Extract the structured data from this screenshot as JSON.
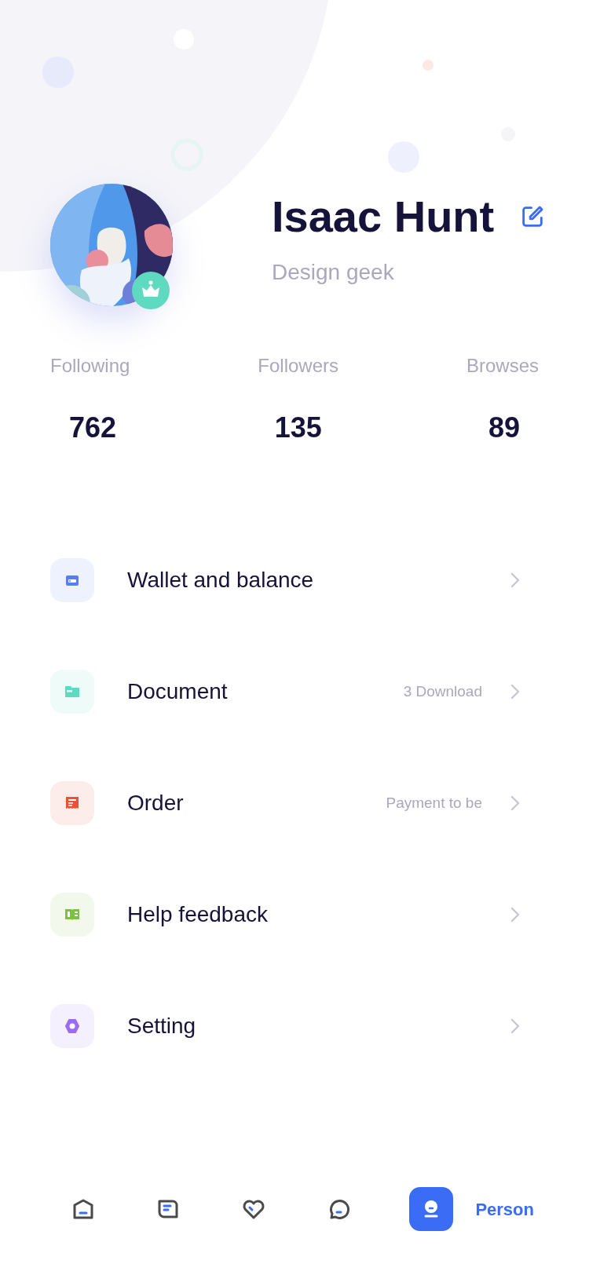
{
  "profile": {
    "name": "Isaac Hunt",
    "subtitle": "Design geek"
  },
  "stats": [
    {
      "label": "Following",
      "value": "762"
    },
    {
      "label": "Followers",
      "value": "135"
    },
    {
      "label": "Browses",
      "value": "89"
    }
  ],
  "menu": [
    {
      "kind": "wallet",
      "label": "Wallet and balance",
      "color": "#5b7cf7"
    },
    {
      "kind": "folder",
      "label": "Document",
      "note": "3 Download",
      "color": "#5fd9c0"
    },
    {
      "kind": "receipt",
      "label": "Order",
      "note": "Payment to be",
      "color": "#f04f35"
    },
    {
      "kind": "book",
      "label": "Help feedback",
      "color": "#7cc242"
    },
    {
      "kind": "hexagon",
      "label": "Setting",
      "color": "#9b6bf5"
    }
  ],
  "tab_bar": [
    {
      "kind": "home",
      "selected": false
    },
    {
      "kind": "notes",
      "selected": false
    },
    {
      "kind": "heart",
      "selected": false
    },
    {
      "kind": "chat",
      "selected": false
    },
    {
      "kind": "person",
      "label": "Person",
      "selected": true
    }
  ]
}
